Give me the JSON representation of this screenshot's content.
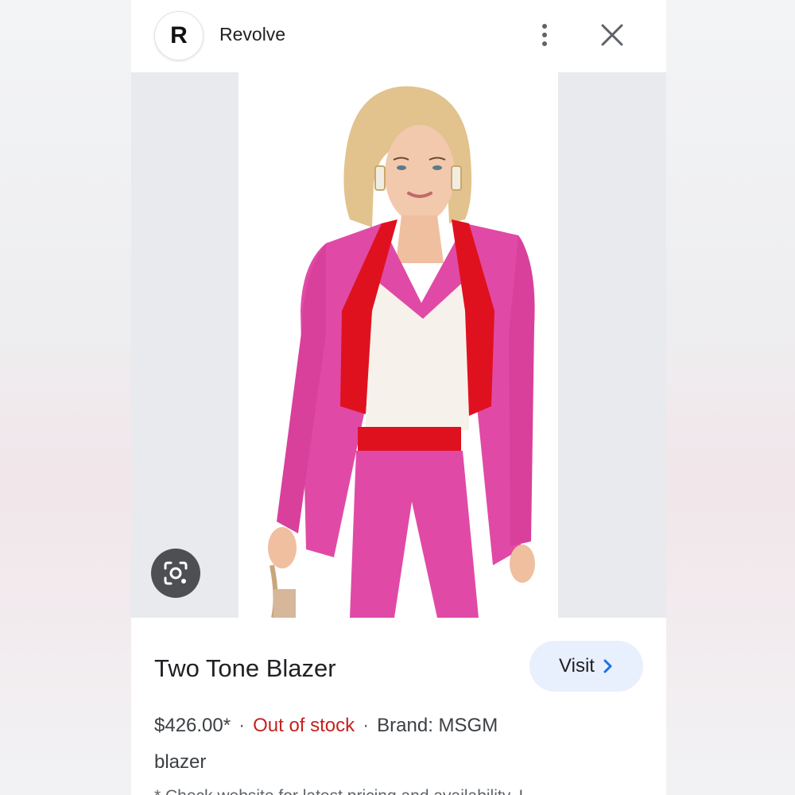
{
  "header": {
    "logo_letter": "R",
    "site_name": "Revolve"
  },
  "product": {
    "title": "Two Tone Blazer",
    "price": "$426.00*",
    "separator": "·",
    "stock_status": "Out of stock",
    "brand": "Brand: MSGM",
    "category": "blazer",
    "disclaimer": "* Check website for latest pricing and availability. I"
  },
  "actions": {
    "visit_label": "Visit"
  },
  "icons": {
    "more": "more-vert-icon",
    "close": "close-icon",
    "lens": "google-lens-icon",
    "visit_chevron": "chevron-right-icon"
  },
  "colors": {
    "blazer_pink": "#e04aa6",
    "lapel_red": "#e0111f",
    "stock_red": "#c5221f",
    "visit_bg": "#e8f0fe",
    "chevron_blue": "#1a73e8"
  }
}
